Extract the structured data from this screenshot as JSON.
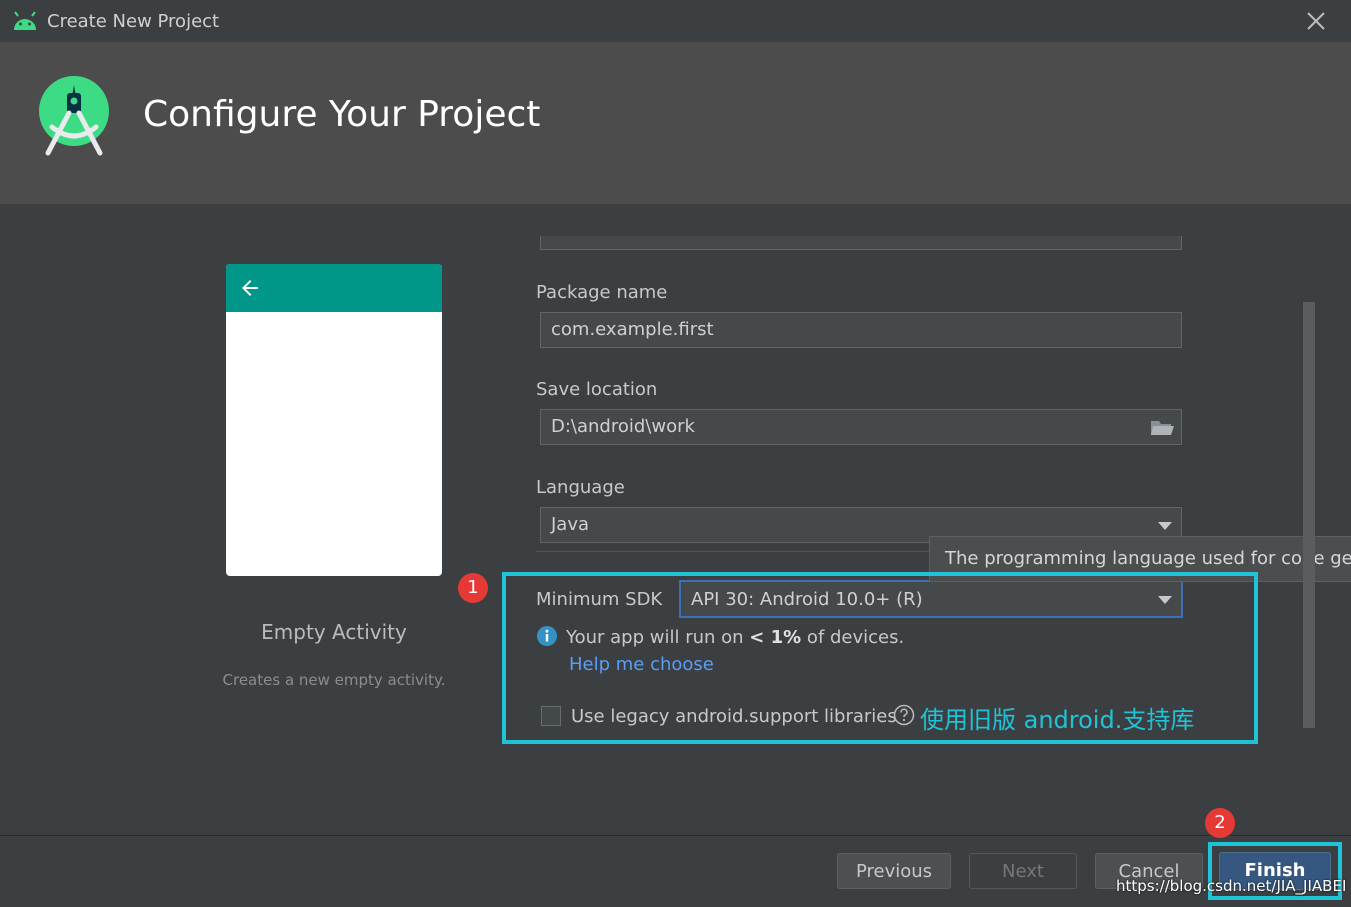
{
  "window": {
    "title": "Create New Project",
    "close_icon": "close-icon",
    "app_icon": "android-icon"
  },
  "header": {
    "title": "Configure Your Project",
    "logo_icon": "android-studio-logo"
  },
  "template": {
    "name": "Empty Activity",
    "description": "Creates a new empty activity.",
    "preview_toolbar_color": "#009688",
    "back_icon": "arrow-back-icon"
  },
  "form": {
    "package_name": {
      "label": "Package name",
      "value": "com.example.first"
    },
    "save_location": {
      "label": "Save location",
      "value": "D:\\android\\work",
      "browse_icon": "folder-icon"
    },
    "language": {
      "label": "Language",
      "value": "Java",
      "tooltip": "The programming language used for code gene"
    },
    "minimum_sdk": {
      "label": "Minimum SDK",
      "value": "API 30: Android 10.0+ (R)"
    },
    "info": {
      "prefix": "Your app will run on ",
      "emphasis": "< 1%",
      "suffix": " of devices.",
      "help_link": "Help me choose"
    },
    "legacy": {
      "label": "Use legacy android.support libraries",
      "checked": false,
      "annotation": "使用旧版 android.支持库"
    }
  },
  "annotations": {
    "badge_1": "1",
    "badge_2": "2",
    "highlight_color": "#1ec3d8"
  },
  "footer": {
    "previous": "Previous",
    "next": "Next",
    "cancel": "Cancel",
    "finish": "Finish",
    "watermark": "https://blog.csdn.net/JIA_JIABEI"
  }
}
